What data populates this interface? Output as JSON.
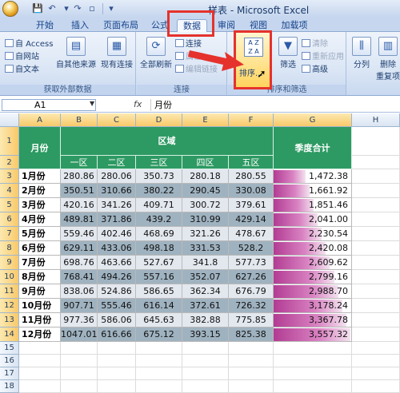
{
  "window": {
    "title": "样表 - Microsoft Excel"
  },
  "quick_access": {
    "save_icon": "floppy-icon",
    "undo_icon": "undo-icon",
    "redo_icon": "redo-icon",
    "qa_icon": "print-preview-icon"
  },
  "tabs": [
    "开始",
    "插入",
    "页面布局",
    "公式",
    "数据",
    "审阅",
    "视图",
    "加载项"
  ],
  "active_tab": "数据",
  "ribbon": {
    "external_group": {
      "label": "获取外部数据",
      "access": "自 Access",
      "web": "自网站",
      "text": "自文本",
      "other": "自其他来源",
      "existing": "现有连接"
    },
    "connections_group": {
      "label": "连接",
      "refresh": "全部刷新",
      "connections": "连接",
      "properties": "属性",
      "edit_links": "编辑链接"
    },
    "sort_group": {
      "label": "排序和筛选",
      "sort": "排序...",
      "filter": "筛选",
      "clear": "清除",
      "reapply": "重新应用",
      "advanced": "高级",
      "sort_icon_az": "A Z",
      "sort_icon_za": "Z A"
    },
    "tools_group": {
      "split": "分列",
      "remove_dup": "删除\n重复项"
    }
  },
  "formula_bar": {
    "name_box": "A1",
    "fx": "fx",
    "value": "月份"
  },
  "columns": [
    "A",
    "B",
    "C",
    "D",
    "E",
    "F",
    "G",
    "H"
  ],
  "rows": [
    "1",
    "2",
    "3",
    "4",
    "5",
    "6",
    "7",
    "8",
    "9",
    "10",
    "11",
    "12",
    "13",
    "14",
    "15",
    "16",
    "17",
    "18"
  ],
  "table": {
    "month_header": "月份",
    "region_header": "区域",
    "total_header": "季度合计",
    "regions": [
      "一区",
      "二区",
      "三区",
      "四区",
      "五区"
    ],
    "data": [
      {
        "month": "1月份",
        "values": [
          "280.86",
          "280.06",
          "350.73",
          "280.18",
          "280.55"
        ],
        "total": "1,472.38",
        "total_value": 1472.38
      },
      {
        "month": "2月份",
        "values": [
          "350.51",
          "310.66",
          "380.22",
          "290.45",
          "330.08"
        ],
        "total": "1,661.92",
        "total_value": 1661.92
      },
      {
        "month": "3月份",
        "values": [
          "420.16",
          "341.26",
          "409.71",
          "300.72",
          "379.61"
        ],
        "total": "1,851.46",
        "total_value": 1851.46
      },
      {
        "month": "4月份",
        "values": [
          "489.81",
          "371.86",
          "439.2",
          "310.99",
          "429.14"
        ],
        "total": "2,041.00",
        "total_value": 2041.0
      },
      {
        "month": "5月份",
        "values": [
          "559.46",
          "402.46",
          "468.69",
          "321.26",
          "478.67"
        ],
        "total": "2,230.54",
        "total_value": 2230.54
      },
      {
        "month": "6月份",
        "values": [
          "629.11",
          "433.06",
          "498.18",
          "331.53",
          "528.2"
        ],
        "total": "2,420.08",
        "total_value": 2420.08
      },
      {
        "month": "7月份",
        "values": [
          "698.76",
          "463.66",
          "527.67",
          "341.8",
          "577.73"
        ],
        "total": "2,609.62",
        "total_value": 2609.62
      },
      {
        "month": "8月份",
        "values": [
          "768.41",
          "494.26",
          "557.16",
          "352.07",
          "627.26"
        ],
        "total": "2,799.16",
        "total_value": 2799.16
      },
      {
        "month": "9月份",
        "values": [
          "838.06",
          "524.86",
          "586.65",
          "362.34",
          "676.79"
        ],
        "total": "2,988.70",
        "total_value": 2988.7
      },
      {
        "month": "10月份",
        "values": [
          "907.71",
          "555.46",
          "616.14",
          "372.61",
          "726.32"
        ],
        "total": "3,178.24",
        "total_value": 3178.24
      },
      {
        "month": "11月份",
        "values": [
          "977.36",
          "586.06",
          "645.63",
          "382.88",
          "775.85"
        ],
        "total": "3,367.78",
        "total_value": 3367.78
      },
      {
        "month": "12月份",
        "values": [
          "1047.01",
          "616.66",
          "675.12",
          "393.15",
          "825.38"
        ],
        "total": "3,557.32",
        "total_value": 3557.32
      }
    ],
    "max_total": 3557.32
  },
  "colors": {
    "header_green": "#2d9a63",
    "row_light": "#e3e8ef",
    "row_dark": "#8da4b5",
    "bar": "#c04fa2",
    "highlight": "#e5322d"
  }
}
